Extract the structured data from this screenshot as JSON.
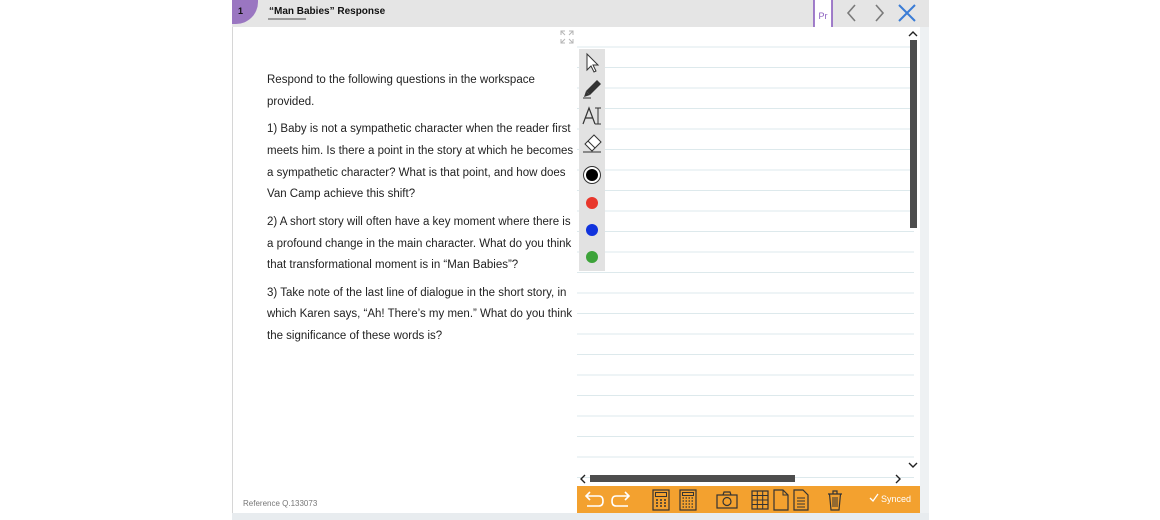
{
  "question": {
    "number": "1",
    "title": "“Man Babies” Response",
    "intro": "Respond to the following questions in the workspace provided.",
    "items": [
      "1) Baby is not a sympathetic character when the reader first meets him. Is there a point in the story at which he becomes a sympathetic character? What is that point, and how does Van Camp achieve this shift?",
      "2) A short story will often have a key moment where there is a profound change in the main character. What do you think that transformational moment is in “Man Babies”?",
      "3) Take note of the last line of dialogue in the short story, in which Karen says, “Ah! There’s my men.” What do you think the significance of these words is?"
    ],
    "reference": "Reference Q.133073"
  },
  "header": {
    "bookmark_label": "Pr",
    "icons": [
      "expand-icon",
      "bookmark-icon",
      "chevron-left-icon",
      "chevron-right-icon",
      "close-icon"
    ]
  },
  "tools": {
    "icons": [
      "arrow-cursor-icon",
      "pen-icon",
      "text-tool-icon",
      "eraser-icon"
    ],
    "colors": [
      "#000000",
      "#e8372c",
      "#1133dd",
      "#3da33a"
    ]
  },
  "bottom_bar": {
    "icons": [
      "undo-icon",
      "redo-icon",
      "calculator-icon",
      "scientific-calculator-icon",
      "camera-icon",
      "table-icon",
      "document-icon",
      "notes-icon",
      "trash-icon"
    ],
    "status": "Synced",
    "background": "#f3a12f"
  },
  "colors": {
    "accent": "#9a76c1",
    "scrollbar": "#4d4d4d"
  }
}
